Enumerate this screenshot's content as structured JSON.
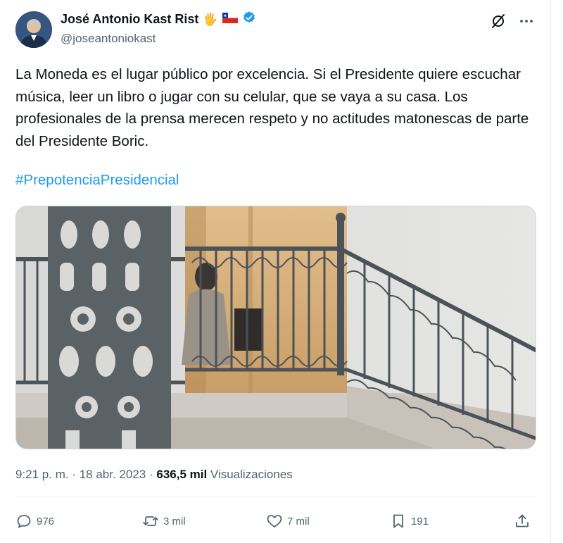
{
  "author": {
    "name": "José Antonio Kast Rist",
    "emoji_hand": "🖐",
    "handle": "@joseantoniokast"
  },
  "tweet": {
    "text": "La Moneda es el lugar público por excelencia. Si el Presidente quiere escuchar música, leer un libro o jugar con su celular, que se vaya a su casa. Los profesionales de la prensa merecen respeto y no actitudes matonescas de parte del Presidente Boric.",
    "hashtag": "#PrepotenciaPresidencial"
  },
  "meta": {
    "time": "9:21 p. m.",
    "sep1": " · ",
    "date": "18 abr. 2023",
    "sep2": " · ",
    "views_count": "636,5 mil",
    "views_label": " Visualizaciones"
  },
  "actions": {
    "replies": "976",
    "reposts": "3 mil",
    "likes": "7 mil",
    "bookmarks": "191"
  },
  "colors": {
    "accent": "#1d9bf0",
    "text": "#0f1419",
    "muted": "#536471"
  }
}
